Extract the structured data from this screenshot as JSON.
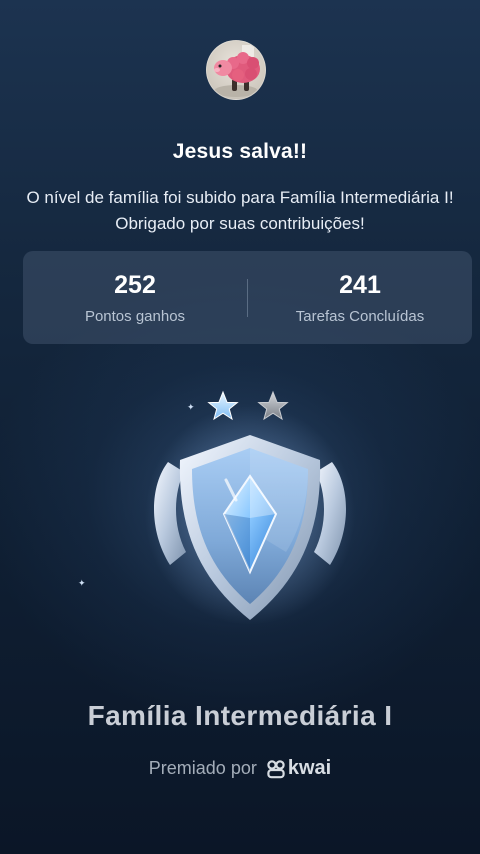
{
  "profile": {
    "avatar_icon": "sheep-plush-avatar",
    "username": "Jesus salva!!"
  },
  "message": "O nível de família foi subido para Família Intermediária I! Obrigado por suas contribuições!",
  "stats": [
    {
      "value": "252",
      "label": "Pontos ganhos"
    },
    {
      "value": "241",
      "label": "Tarefas Concluídas"
    }
  ],
  "badge": {
    "icon": "shield-diamond-badge-icon",
    "stars_filled": 1,
    "stars_total": 2,
    "star_colors": [
      "#bfe0ff",
      "#8d9299"
    ]
  },
  "level_title": "Família Intermediária I",
  "awarded": {
    "prefix": "Premiado por",
    "brand": "kwai",
    "brand_icon": "kwai-logo-icon"
  },
  "colors": {
    "background_top": "#1c3350",
    "background_bottom": "#0b1627",
    "card": "#3b4b61",
    "muted_text": "#b8c4d3"
  }
}
